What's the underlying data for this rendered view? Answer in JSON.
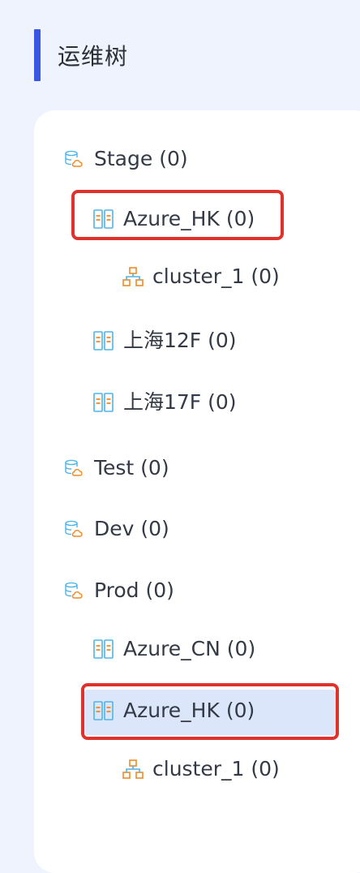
{
  "header": {
    "title": "运维树"
  },
  "colors": {
    "accent": "#3a56e0",
    "highlight": "#e0322c",
    "selected_bg": "#dce6fb",
    "icon_blue": "#4fb4e6",
    "icon_orange": "#f08a24"
  },
  "tree": {
    "stage": {
      "label": "Stage (0)"
    },
    "stage_azure_hk": {
      "label": "Azure_HK (0)"
    },
    "stage_azure_hk_cluster_1": {
      "label": "cluster_1 (0)"
    },
    "stage_shanghai_12f": {
      "label": "上海12F (0)"
    },
    "stage_shanghai_17f": {
      "label": "上海17F (0)"
    },
    "test": {
      "label": "Test (0)"
    },
    "dev": {
      "label": "Dev (0)"
    },
    "prod": {
      "label": "Prod (0)"
    },
    "prod_azure_cn": {
      "label": "Azure_CN (0)"
    },
    "prod_azure_hk": {
      "label": "Azure_HK (0)",
      "selected": true
    },
    "prod_azure_hk_cluster_1": {
      "label": "cluster_1 (0)"
    }
  }
}
